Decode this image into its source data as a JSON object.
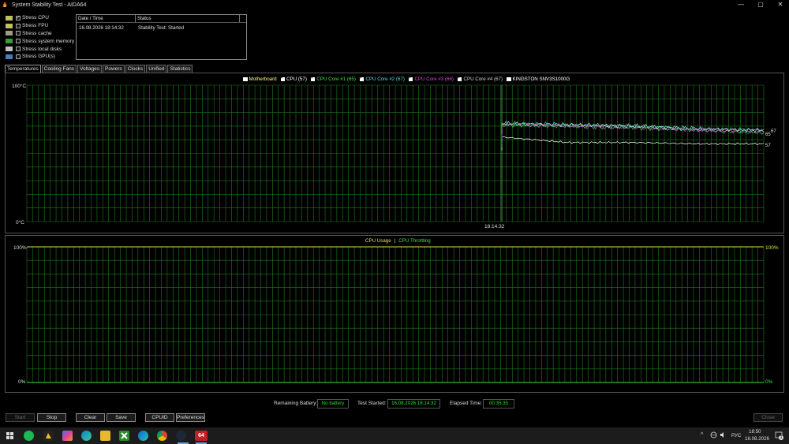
{
  "window": {
    "title": "System Stability Test - AIDA64",
    "controls": {
      "minimize": "—",
      "maximize": "▢",
      "close": "✕"
    }
  },
  "stress_options": [
    {
      "label": "Stress CPU",
      "checked": true,
      "icon": "cpu-icon",
      "color": "#c0c060"
    },
    {
      "label": "Stress FPU",
      "checked": false,
      "icon": "fpu-icon",
      "color": "#c0c060"
    },
    {
      "label": "Stress cache",
      "checked": false,
      "icon": "cache-icon",
      "color": "#a0a080"
    },
    {
      "label": "Stress system memory",
      "checked": false,
      "icon": "memory-icon",
      "color": "#30a030"
    },
    {
      "label": "Stress local disks",
      "checked": false,
      "icon": "disk-icon",
      "color": "#c0c0c0"
    },
    {
      "label": "Stress GPU(s)",
      "checked": false,
      "icon": "gpu-icon",
      "color": "#4080c0"
    }
  ],
  "log": {
    "headers": [
      "Date / Time",
      "Status"
    ],
    "rows": [
      {
        "datetime": "16.08.2026 18:14:32",
        "status": "Stability Test: Started"
      }
    ]
  },
  "tabs": [
    "Temperatures",
    "Cooling Fans",
    "Voltages",
    "Powers",
    "Clocks",
    "Unified",
    "Statistics"
  ],
  "active_tab": "Temperatures",
  "temp_chart": {
    "legend": [
      {
        "label": "Motherboard",
        "checked": false,
        "color": "#ffff80"
      },
      {
        "label": "CPU (57)",
        "checked": true,
        "color": "#ffffff"
      },
      {
        "label": "CPU Core #1 (65)",
        "checked": true,
        "color": "#40e040"
      },
      {
        "label": "CPU Core #2 (67)",
        "checked": true,
        "color": "#40e0e0"
      },
      {
        "label": "CPU Core #3 (66)",
        "checked": true,
        "color": "#e040e0"
      },
      {
        "label": "CPU Core #4 (67)",
        "checked": true,
        "color": "#d0d0d0"
      },
      {
        "label": "KINGSTON SNV3S1000G",
        "checked": false,
        "color": "#ffffff"
      }
    ],
    "y_top_label": "100°C",
    "y_bottom_label": "0°C",
    "time_label": "18:14:32",
    "end_values": [
      "67",
      "65",
      "57"
    ]
  },
  "usage_chart": {
    "legend": [
      {
        "label": "CPU Usage",
        "color": "#e0e040"
      },
      {
        "separator": "|"
      },
      {
        "label": "CPU Throttling",
        "color": "#40e040"
      }
    ],
    "y_top_label": "100%",
    "y_bottom_label": "0%",
    "right_top_label": "100%",
    "right_bottom_label": "0%"
  },
  "chart_data": [
    {
      "type": "line",
      "title": "",
      "ylim": [
        0,
        100
      ],
      "x": [
        "18:14:32"
      ],
      "series": [
        {
          "name": "CPU (57)",
          "values": [
            62,
            58,
            58,
            57,
            57
          ]
        },
        {
          "name": "CPU Core #1 (65)",
          "values": [
            71,
            70,
            69,
            67,
            65
          ]
        },
        {
          "name": "CPU Core #2 (67)",
          "values": [
            72,
            71,
            70,
            68,
            67
          ]
        },
        {
          "name": "CPU Core #3 (66)",
          "values": [
            71,
            70,
            69,
            67,
            66
          ]
        },
        {
          "name": "CPU Core #4 (67)",
          "values": [
            72,
            71,
            70,
            68,
            67
          ]
        }
      ]
    },
    {
      "type": "line",
      "title": "",
      "ylim": [
        0,
        100
      ],
      "series": [
        {
          "name": "CPU Usage",
          "values": [
            100,
            100,
            100,
            100,
            100
          ]
        },
        {
          "name": "CPU Throttling",
          "values": [
            0,
            0,
            0,
            0,
            0
          ]
        }
      ]
    }
  ],
  "status": {
    "battery_label": "Remaining Battery:",
    "battery_value": "No battery",
    "started_label": "Test Started:",
    "started_value": "16.08.2026 18:14:32",
    "elapsed_label": "Elapsed Time:",
    "elapsed_value": "00:35:35"
  },
  "buttons": {
    "start": "Start",
    "stop": "Stop",
    "clear": "Clear",
    "save": "Save",
    "cpuid": "CPUID",
    "preferences": "Preferences",
    "close": "Close"
  },
  "taskbar": {
    "language": "РУС",
    "time": "18:50",
    "date": "16.08.2026",
    "notification_count": "1",
    "apps": [
      "windows-icon",
      "spotify-icon",
      "winamp-icon",
      "copilot-icon",
      "edge-icon",
      "explorer-icon",
      "xbox-icon",
      "edge-dev-icon",
      "chrome-icon",
      "steam-icon",
      "aida64-icon"
    ],
    "aida_label": "64"
  }
}
